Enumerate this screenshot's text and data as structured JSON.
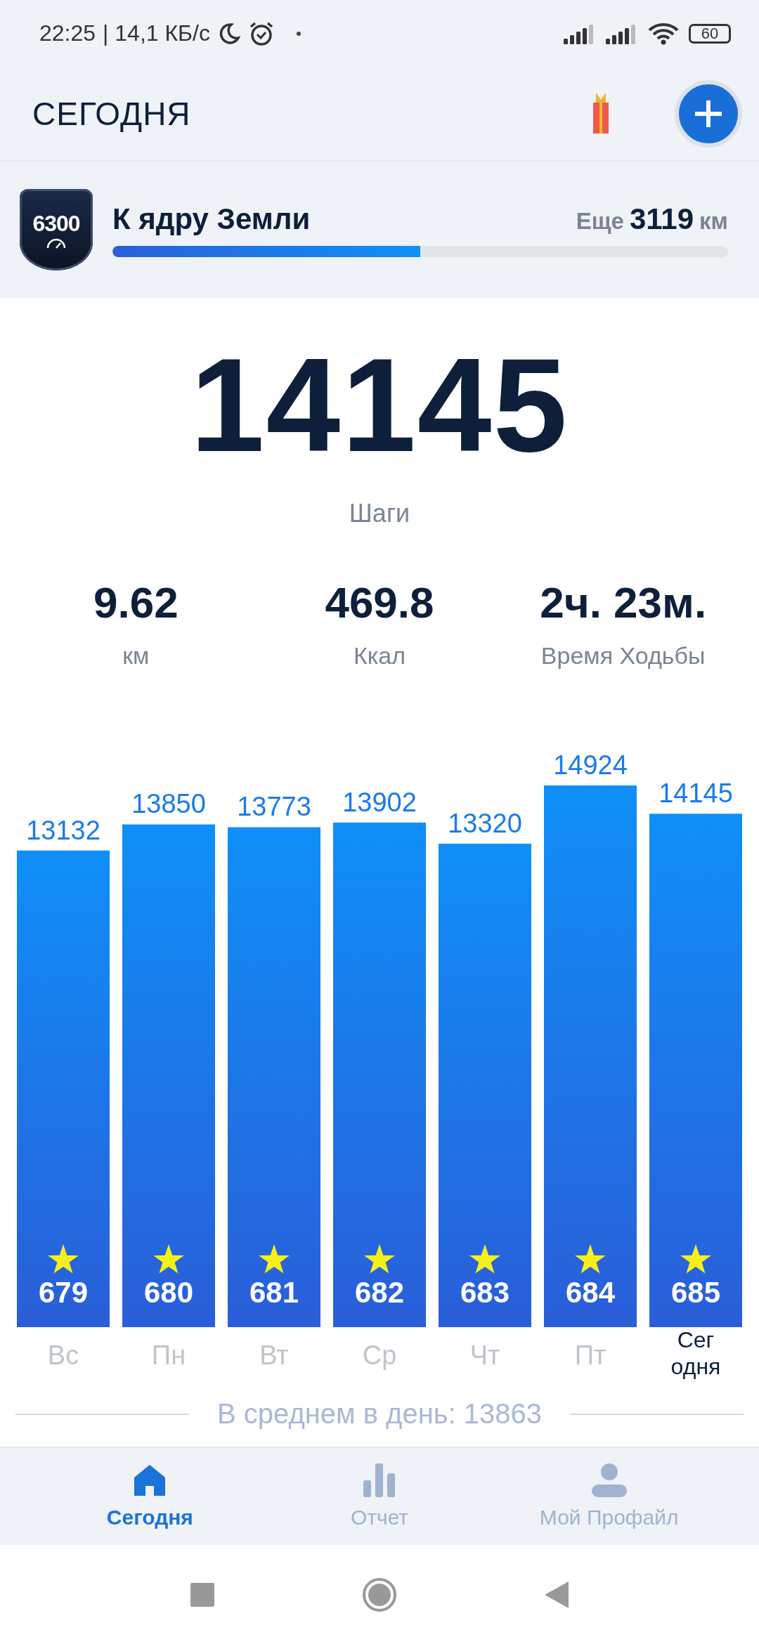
{
  "status_bar": {
    "time": "22:25",
    "network_speed": "| 14,1 КБ/с",
    "battery": "60"
  },
  "header": {
    "title": "СЕГОДНЯ"
  },
  "goal": {
    "badge": "6300",
    "title": "К ядру Земли",
    "remaining_label": "Еще",
    "remaining_value": "3119",
    "remaining_unit": "км",
    "level": 0.5
  },
  "summary": {
    "steps": "14145",
    "steps_label": "Шаги",
    "stats": [
      {
        "value": "9.62",
        "label": "км"
      },
      {
        "value": "469.8",
        "label": "Ккал"
      },
      {
        "value": "2ч. 23м.",
        "label": "Время Ходьбы"
      }
    ]
  },
  "week": {
    "chart_data": {
      "type": "bar",
      "categories": [
        "Вс",
        "Пн",
        "Вт",
        "Ср",
        "Чт",
        "Пт",
        "Сег\nодня"
      ],
      "values": [
        13132,
        13850,
        13773,
        13902,
        13320,
        14924,
        14145
      ],
      "data_labels": true
    },
    "days": [
      {
        "badge": "679",
        "selected": false
      },
      {
        "badge": "680",
        "selected": false
      },
      {
        "badge": "681",
        "selected": false
      },
      {
        "badge": "682",
        "selected": false
      },
      {
        "badge": "683",
        "selected": false
      },
      {
        "badge": "684",
        "selected": false
      },
      {
        "badge": "685",
        "selected": true
      }
    ]
  },
  "average": "В среднем в день: 13863",
  "nav": [
    {
      "label": "Сегодня",
      "selected": true
    },
    {
      "label": "Отчет",
      "selected": false
    },
    {
      "label": "Мой Профайл",
      "selected": false
    }
  ]
}
